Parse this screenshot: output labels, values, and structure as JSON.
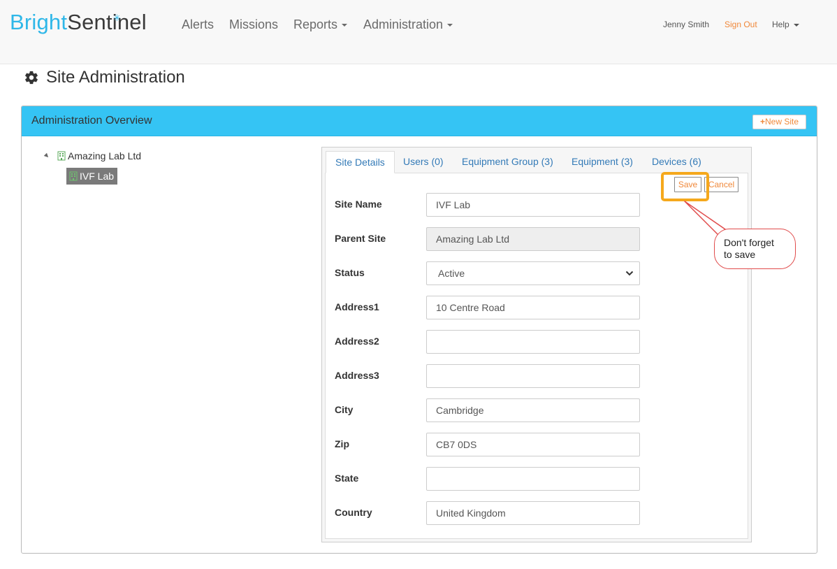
{
  "brand": {
    "part1": "Bright",
    "part2": "Sentinel"
  },
  "nav": {
    "alerts": "Alerts",
    "missions": "Missions",
    "reports": "Reports",
    "administration": "Administration",
    "user_name": "Jenny Smith",
    "sign_out": "Sign Out",
    "help": "Help"
  },
  "page": {
    "title": "Site Administration"
  },
  "panel": {
    "title": "Administration Overview",
    "new_site_label": "New Site"
  },
  "tree": {
    "root": "Amazing Lab Ltd",
    "child": "IVF Lab"
  },
  "tabs": [
    {
      "label": "Site Details"
    },
    {
      "label": "Users (0)"
    },
    {
      "label": "Equipment Group (3)"
    },
    {
      "label": "Equipment (3)"
    },
    {
      "label": "Devices (6)"
    }
  ],
  "actions": {
    "save": "Save",
    "cancel": "Cancel"
  },
  "form": {
    "site_name": {
      "label": "Site Name",
      "value": "IVF Lab"
    },
    "parent_site": {
      "label": "Parent Site",
      "value": "Amazing Lab Ltd"
    },
    "status": {
      "label": "Status",
      "value": "Active"
    },
    "address1": {
      "label": "Address1",
      "value": "10 Centre Road"
    },
    "address2": {
      "label": "Address2",
      "value": ""
    },
    "address3": {
      "label": "Address3",
      "value": ""
    },
    "city": {
      "label": "City",
      "value": "Cambridge"
    },
    "zip": {
      "label": "Zip",
      "value": "CB7 0DS"
    },
    "state": {
      "label": "State",
      "value": ""
    },
    "country": {
      "label": "Country",
      "value": "United Kingdom"
    }
  },
  "callout": {
    "line1": "Don't forget",
    "line2": "to save"
  },
  "colors": {
    "accent": "#35c4f4",
    "brand_blue": "#2fb7e8",
    "action_orange": "#f0883a",
    "highlight": "#f5a81c",
    "callout_red": "#e04b4b"
  },
  "icons": {
    "page": "gear-icon",
    "new_site": "plus-icon",
    "tree_node": "building-icon",
    "tree_toggle": "triangle-down-icon",
    "select": "chevron-down-icon"
  }
}
